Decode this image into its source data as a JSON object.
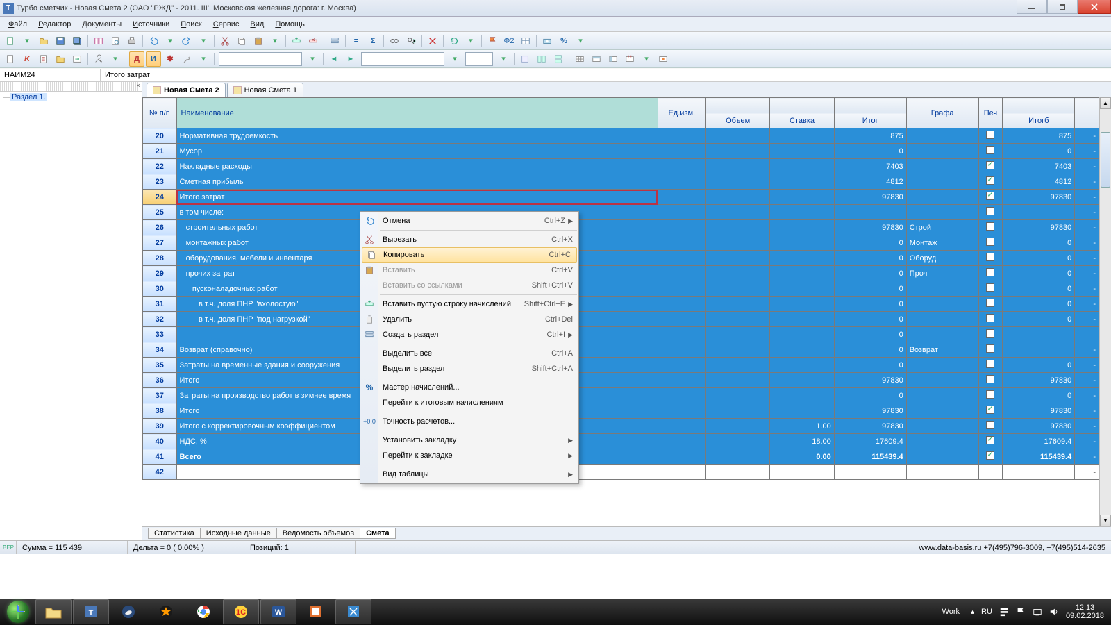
{
  "window": {
    "title": "Турбо сметчик - Новая Смета 2 (ОАО \"РЖД\" - 2011. III'. Московская железная дорога: г. Москва)",
    "app_icon_letter": "T"
  },
  "menu": [
    "Файл",
    "Редактор",
    "Документы",
    "Источники",
    "Поиск",
    "Сервис",
    "Вид",
    "Помощь"
  ],
  "toolbar2_letters": {
    "d": "Д",
    "i": "И",
    "star": "✱"
  },
  "formula": {
    "ref": "НАИМ24",
    "val": "Итого затрат"
  },
  "tree": {
    "node": "Раздел 1."
  },
  "doc_tabs": [
    {
      "label": "Новая Смета 2",
      "active": true
    },
    {
      "label": "Новая Смета 1",
      "active": false
    }
  ],
  "grid": {
    "headers": {
      "num": "№ п/п",
      "name": "Наименование",
      "unit": "Ед.изм.",
      "vol": "Объем",
      "rate": "Ставка",
      "itog": "Итог",
      "grafa": "Графа",
      "pech": "Печ",
      "itogb": "Итогб"
    },
    "rows": [
      {
        "n": "20",
        "name": "Нормативная трудоемкость",
        "itog": "875",
        "grafa": "",
        "ck": false,
        "itogb": "875",
        "last": "-"
      },
      {
        "n": "21",
        "name": "Мусор",
        "itog": "0",
        "grafa": "",
        "ck": false,
        "itogb": "0",
        "last": "-"
      },
      {
        "n": "22",
        "name": "Накладные расходы",
        "itog": "7403",
        "grafa": "",
        "ck": true,
        "itogb": "7403",
        "last": "-"
      },
      {
        "n": "23",
        "name": "Сметная прибыль",
        "itog": "4812",
        "grafa": "",
        "ck": true,
        "itogb": "4812",
        "last": "-"
      },
      {
        "n": "24",
        "name": "Итого затрат",
        "itog": "97830",
        "grafa": "",
        "ck": true,
        "itogb": "97830",
        "last": "-",
        "current": true
      },
      {
        "n": "25",
        "name": "в том числе:",
        "itog": "",
        "grafa": "",
        "ck": false,
        "itogb": "",
        "last": "-"
      },
      {
        "n": "26",
        "name": "   строительных работ",
        "itog": "97830",
        "grafa": "Строй",
        "ck": false,
        "itogb": "97830",
        "last": "-"
      },
      {
        "n": "27",
        "name": "   монтажных работ",
        "itog": "0",
        "grafa": "Монтаж",
        "ck": false,
        "itogb": "0",
        "last": "-"
      },
      {
        "n": "28",
        "name": "   оборудования, мебели и инвентаря",
        "itog": "0",
        "grafa": "Оборуд",
        "ck": false,
        "itogb": "0",
        "last": "-"
      },
      {
        "n": "29",
        "name": "   прочих затрат",
        "itog": "0",
        "grafa": "Проч",
        "ck": false,
        "itogb": "0",
        "last": "-"
      },
      {
        "n": "30",
        "name": "      пусконаладочных работ",
        "itog": "0",
        "grafa": "",
        "ck": false,
        "itogb": "0",
        "last": "-"
      },
      {
        "n": "31",
        "name": "         в т.ч. доля ПНР \"вхолостую\"",
        "itog": "0",
        "grafa": "",
        "ck": false,
        "itogb": "0",
        "last": "-"
      },
      {
        "n": "32",
        "name": "         в т.ч. доля ПНР \"под нагрузкой\"",
        "itog": "0",
        "grafa": "",
        "ck": false,
        "itogb": "0",
        "last": "-"
      },
      {
        "n": "33",
        "name": "",
        "itog": "0",
        "grafa": "",
        "ck": false,
        "itogb": "",
        "last": ""
      },
      {
        "n": "34",
        "name": "Возврат (справочно)",
        "itog": "0",
        "grafa": "Возврат",
        "ck": false,
        "itogb": "",
        "last": "-"
      },
      {
        "n": "35",
        "name": "Затраты на временные здания и сооружения",
        "itog": "0",
        "grafa": "",
        "ck": false,
        "itogb": "0",
        "last": "-"
      },
      {
        "n": "36",
        "name": "Итого",
        "itog": "97830",
        "grafa": "",
        "ck": false,
        "itogb": "97830",
        "last": "-"
      },
      {
        "n": "37",
        "name": "Затраты на производство работ в зимнее время",
        "itog": "0",
        "grafa": "",
        "ck": false,
        "itogb": "0",
        "last": "-"
      },
      {
        "n": "38",
        "name": "Итого",
        "itog": "97830",
        "grafa": "",
        "ck": true,
        "itogb": "97830",
        "last": "-"
      },
      {
        "n": "39",
        "name": "Итого с корректировочным коэффициентом",
        "rate": "1.00",
        "itog": "97830",
        "grafa": "",
        "ck": false,
        "itogb": "97830",
        "last": "-"
      },
      {
        "n": "40",
        "name": "НДС, %",
        "rate": "18.00",
        "itog": "17609.4",
        "grafa": "",
        "ck": true,
        "itogb": "17609.4",
        "last": "-"
      },
      {
        "n": "41",
        "name": "Всего",
        "rate": "0.00",
        "itog": "115439.4",
        "grafa": "",
        "ck": true,
        "itogb": "115439.4",
        "last": "-",
        "bold": true
      },
      {
        "n": "42",
        "name": "",
        "itog": "",
        "grafa": "",
        "itogb": "",
        "last": "-",
        "plain": true
      }
    ]
  },
  "context_menu": [
    {
      "label": "Отмена",
      "shortcut": "Ctrl+Z",
      "sub": true,
      "icon": "undo"
    },
    {
      "sep": true
    },
    {
      "label": "Вырезать",
      "shortcut": "Ctrl+X",
      "icon": "cut"
    },
    {
      "label": "Копировать",
      "shortcut": "Ctrl+C",
      "icon": "copy",
      "hl": true
    },
    {
      "label": "Вставить",
      "shortcut": "Ctrl+V",
      "icon": "paste",
      "disabled": true
    },
    {
      "label": "Вставить со ссылками",
      "shortcut": "Shift+Ctrl+V",
      "disabled": true
    },
    {
      "sep": true
    },
    {
      "label": "Вставить пустую строку начислений",
      "shortcut": "Shift+Ctrl+E",
      "sub": true,
      "icon": "rowins"
    },
    {
      "label": "Удалить",
      "shortcut": "Ctrl+Del",
      "icon": "del"
    },
    {
      "label": "Создать раздел",
      "shortcut": "Ctrl+I",
      "sub": true,
      "icon": "section"
    },
    {
      "sep": true
    },
    {
      "label": "Выделить все",
      "shortcut": "Ctrl+A"
    },
    {
      "label": "Выделить раздел",
      "shortcut": "Shift+Ctrl+A"
    },
    {
      "sep": true
    },
    {
      "label": "Мастер начислений...",
      "icon": "pct"
    },
    {
      "label": "Перейти к итоговым начислениям"
    },
    {
      "sep": true
    },
    {
      "label": "Точность расчетов...",
      "icon": "prec"
    },
    {
      "sep": true
    },
    {
      "label": "Установить закладку",
      "sub": true
    },
    {
      "label": "Перейти к закладке",
      "sub": true
    },
    {
      "sep": true
    },
    {
      "label": "Вид таблицы",
      "sub": true
    }
  ],
  "sheet_tabs": [
    "Статистика",
    "Исходные данные",
    "Ведомость объемов",
    "Смета"
  ],
  "sheet_active": 3,
  "status": {
    "ver": "ВЕР",
    "sum": "Сумма = 115 439",
    "delta": "Дельта = 0 ( 0.00% )",
    "pos": "Позиций: 1",
    "right": "www.data-basis.ru  +7(495)796-3009, +7(495)514-2635"
  },
  "tray": {
    "work": "Work",
    "lang": "RU",
    "time": "12:13",
    "date": "09.02.2018"
  }
}
